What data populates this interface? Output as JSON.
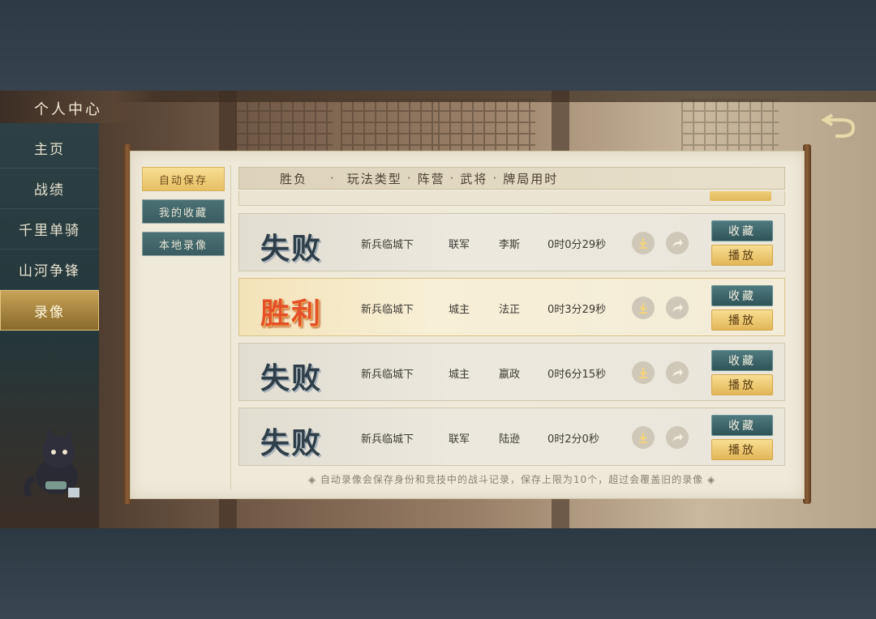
{
  "sidebar": {
    "title": "个人中心",
    "items": [
      {
        "label": "主页"
      },
      {
        "label": "战绩"
      },
      {
        "label": "千里单骑"
      },
      {
        "label": "山河争锋"
      },
      {
        "label": "录像"
      }
    ],
    "active_index": 4
  },
  "subtabs": [
    {
      "label": "自动保存",
      "active": true
    },
    {
      "label": "我的收藏",
      "active": false
    },
    {
      "label": "本地录像",
      "active": false
    }
  ],
  "header": {
    "col_result": "胜负",
    "col_mode": "玩法类型",
    "col_camp": "阵营",
    "col_general": "武将",
    "col_duration": "牌局用时"
  },
  "rows": [
    {
      "result": "失败",
      "win": false,
      "mode": "新兵临城下",
      "camp": "联军",
      "general": "李斯",
      "duration": "0时0分29秒",
      "fav_label": "收藏",
      "play_label": "播放"
    },
    {
      "result": "胜利",
      "win": true,
      "mode": "新兵临城下",
      "camp": "城主",
      "general": "法正",
      "duration": "0时3分29秒",
      "fav_label": "收藏",
      "play_label": "播放"
    },
    {
      "result": "失败",
      "win": false,
      "mode": "新兵临城下",
      "camp": "城主",
      "general": "嬴政",
      "duration": "0时6分15秒",
      "fav_label": "收藏",
      "play_label": "播放"
    },
    {
      "result": "失败",
      "win": false,
      "mode": "新兵临城下",
      "camp": "联军",
      "general": "陆逊",
      "duration": "0时2分0秒",
      "fav_label": "收藏",
      "play_label": "播放"
    }
  ],
  "footnote": "自动录像会保存身份和竞技中的战斗记录，保存上限为10个，超过会覆盖旧的录像",
  "icons": {
    "download": "download-icon",
    "share": "share-icon",
    "back": "back-icon"
  },
  "colors": {
    "accent_gold": "#e2b657",
    "accent_teal": "#3a5c60",
    "win_red": "#e4502a",
    "lose_slate": "#2f3f4a"
  }
}
